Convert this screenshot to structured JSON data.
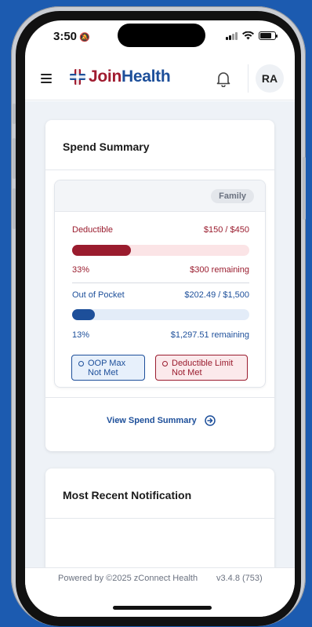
{
  "status_bar": {
    "time": "3:50",
    "mute_symbol": "🔕"
  },
  "header": {
    "logo_join": "Join",
    "logo_health": "Health",
    "avatar_initials": "RA"
  },
  "spend_summary": {
    "title": "Spend Summary",
    "badge": "Family",
    "deductible": {
      "label": "Deductible",
      "amount": "$150 / $450",
      "percent_text": "33%",
      "remaining": "$300 remaining",
      "progress_fraction": 0.33
    },
    "out_of_pocket": {
      "label": "Out of Pocket",
      "amount": "$202.49 / $1,500",
      "percent_text": "13%",
      "remaining": "$1,297.51 remaining",
      "progress_fraction": 0.13
    },
    "oop_status": {
      "line1": "OOP Max",
      "line2": "Not Met"
    },
    "deductible_status": {
      "line1": "Deductible Limit",
      "line2": "Not Met"
    },
    "view_link": "View Spend Summary"
  },
  "notification": {
    "title": "Most Recent Notification"
  },
  "footer": {
    "powered_by": "Powered by ©2025 zConnect Health",
    "version": "v3.4.8 (753)"
  },
  "colors": {
    "brand_red": "#9a1c2e",
    "brand_blue": "#1d4f9a",
    "deductible_track": "#fbe4e6",
    "oop_track": "#e3ecf8"
  }
}
